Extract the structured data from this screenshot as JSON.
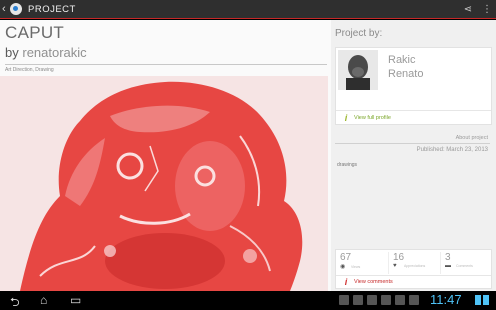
{
  "actionbar": {
    "back_glyph": "‹",
    "title": "PROJECT",
    "share_glyph": "⋖",
    "menu_glyph": "⋮"
  },
  "project": {
    "title": "CAPUT",
    "by_label": "by",
    "author": "renatorakic",
    "fields": "Art Direction, Drawing"
  },
  "sidebar": {
    "project_by_label": "Project by:",
    "owner_first": "Rakic",
    "owner_last": "Renato",
    "view_profile": "View full profile",
    "about_label": "About project",
    "published": "Published: March 23, 2013",
    "tags": "drawings"
  },
  "stats": {
    "views": "67",
    "views_label": "Views",
    "appreciations": "16",
    "appreciations_label": "Appreciations",
    "comments": "3",
    "comments_label": "Comments",
    "view_comments": "View comments"
  },
  "navbar": {
    "back_glyph": "⮌",
    "home_glyph": "⌂",
    "recents_glyph": "▭",
    "time": "11:47"
  },
  "colors": {
    "accent_red": "#c62828",
    "accent_green": "#9bb52a",
    "clock_blue": "#4fc3f7",
    "artwork_red": "#e53935"
  }
}
